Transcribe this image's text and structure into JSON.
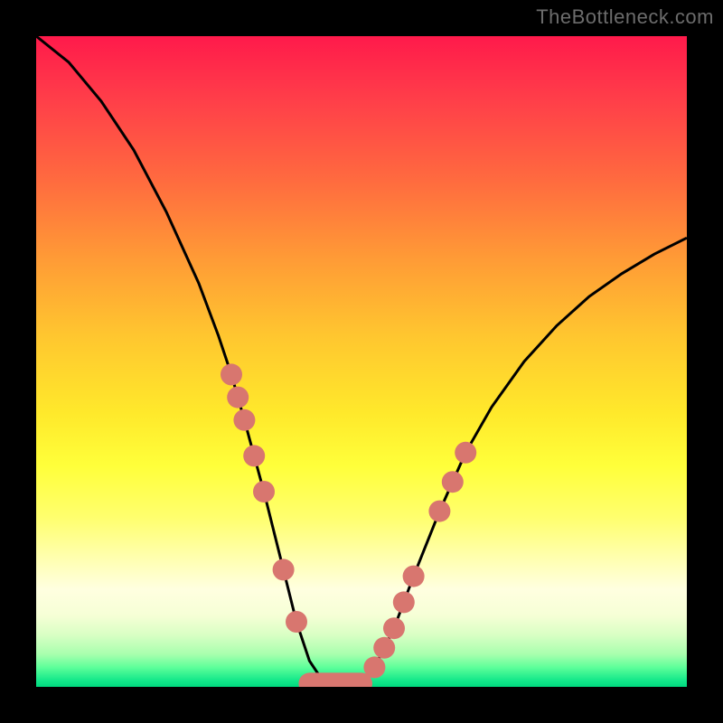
{
  "watermark": "TheBottleneck.com",
  "colors": {
    "background": "#000000",
    "curve": "#000000",
    "dot": "#d8766f",
    "gradient_top": "#ff1a4b",
    "gradient_bottom": "#00d97f"
  },
  "chart_data": {
    "type": "line",
    "title": "",
    "xlabel": "",
    "ylabel": "",
    "xlim": [
      0,
      100
    ],
    "ylim": [
      0,
      100
    ],
    "grid": false,
    "series": [
      {
        "name": "bottleneck-curve",
        "x": [
          0,
          5,
          10,
          15,
          20,
          25,
          28,
          30,
          32,
          35,
          38,
          40,
          42,
          44,
          46,
          48,
          50,
          52,
          55,
          58,
          62,
          66,
          70,
          75,
          80,
          85,
          90,
          95,
          100
        ],
        "values": [
          100,
          96,
          90,
          82.5,
          73,
          62,
          54,
          48,
          41,
          30,
          18,
          10,
          4,
          1,
          0.3,
          0.3,
          0.7,
          3,
          9,
          17,
          27,
          36,
          43,
          50,
          55.5,
          60,
          63.5,
          66.5,
          69
        ]
      }
    ],
    "markers": {
      "left_cluster": [
        [
          30,
          48
        ],
        [
          31,
          44.5
        ],
        [
          32,
          41
        ],
        [
          33.5,
          35.5
        ],
        [
          35,
          30
        ],
        [
          38,
          18
        ],
        [
          40,
          10
        ]
      ],
      "right_cluster": [
        [
          52,
          3
        ],
        [
          53.5,
          6
        ],
        [
          55,
          9
        ],
        [
          56.5,
          13
        ],
        [
          58,
          17
        ],
        [
          62,
          27
        ],
        [
          64,
          31.5
        ],
        [
          66,
          36
        ]
      ],
      "bottom_segment": {
        "x0": 42,
        "x1": 50,
        "y": 0.5
      }
    }
  }
}
